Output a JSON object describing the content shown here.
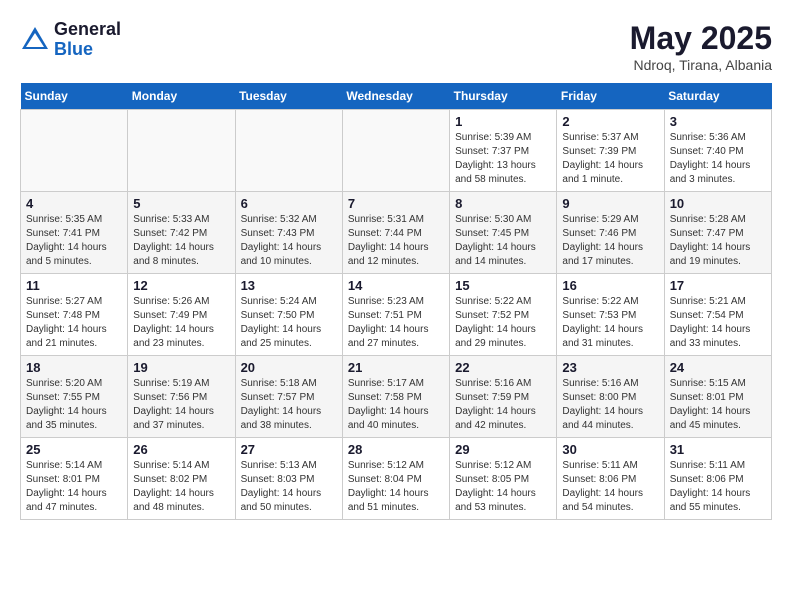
{
  "header": {
    "logo_general": "General",
    "logo_blue": "Blue",
    "month_title": "May 2025",
    "location": "Ndroq, Tirana, Albania"
  },
  "weekdays": [
    "Sunday",
    "Monday",
    "Tuesday",
    "Wednesday",
    "Thursday",
    "Friday",
    "Saturday"
  ],
  "weeks": [
    [
      {
        "day": "",
        "info": ""
      },
      {
        "day": "",
        "info": ""
      },
      {
        "day": "",
        "info": ""
      },
      {
        "day": "",
        "info": ""
      },
      {
        "day": "1",
        "info": "Sunrise: 5:39 AM\nSunset: 7:37 PM\nDaylight: 13 hours\nand 58 minutes."
      },
      {
        "day": "2",
        "info": "Sunrise: 5:37 AM\nSunset: 7:39 PM\nDaylight: 14 hours\nand 1 minute."
      },
      {
        "day": "3",
        "info": "Sunrise: 5:36 AM\nSunset: 7:40 PM\nDaylight: 14 hours\nand 3 minutes."
      }
    ],
    [
      {
        "day": "4",
        "info": "Sunrise: 5:35 AM\nSunset: 7:41 PM\nDaylight: 14 hours\nand 5 minutes."
      },
      {
        "day": "5",
        "info": "Sunrise: 5:33 AM\nSunset: 7:42 PM\nDaylight: 14 hours\nand 8 minutes."
      },
      {
        "day": "6",
        "info": "Sunrise: 5:32 AM\nSunset: 7:43 PM\nDaylight: 14 hours\nand 10 minutes."
      },
      {
        "day": "7",
        "info": "Sunrise: 5:31 AM\nSunset: 7:44 PM\nDaylight: 14 hours\nand 12 minutes."
      },
      {
        "day": "8",
        "info": "Sunrise: 5:30 AM\nSunset: 7:45 PM\nDaylight: 14 hours\nand 14 minutes."
      },
      {
        "day": "9",
        "info": "Sunrise: 5:29 AM\nSunset: 7:46 PM\nDaylight: 14 hours\nand 17 minutes."
      },
      {
        "day": "10",
        "info": "Sunrise: 5:28 AM\nSunset: 7:47 PM\nDaylight: 14 hours\nand 19 minutes."
      }
    ],
    [
      {
        "day": "11",
        "info": "Sunrise: 5:27 AM\nSunset: 7:48 PM\nDaylight: 14 hours\nand 21 minutes."
      },
      {
        "day": "12",
        "info": "Sunrise: 5:26 AM\nSunset: 7:49 PM\nDaylight: 14 hours\nand 23 minutes."
      },
      {
        "day": "13",
        "info": "Sunrise: 5:24 AM\nSunset: 7:50 PM\nDaylight: 14 hours\nand 25 minutes."
      },
      {
        "day": "14",
        "info": "Sunrise: 5:23 AM\nSunset: 7:51 PM\nDaylight: 14 hours\nand 27 minutes."
      },
      {
        "day": "15",
        "info": "Sunrise: 5:22 AM\nSunset: 7:52 PM\nDaylight: 14 hours\nand 29 minutes."
      },
      {
        "day": "16",
        "info": "Sunrise: 5:22 AM\nSunset: 7:53 PM\nDaylight: 14 hours\nand 31 minutes."
      },
      {
        "day": "17",
        "info": "Sunrise: 5:21 AM\nSunset: 7:54 PM\nDaylight: 14 hours\nand 33 minutes."
      }
    ],
    [
      {
        "day": "18",
        "info": "Sunrise: 5:20 AM\nSunset: 7:55 PM\nDaylight: 14 hours\nand 35 minutes."
      },
      {
        "day": "19",
        "info": "Sunrise: 5:19 AM\nSunset: 7:56 PM\nDaylight: 14 hours\nand 37 minutes."
      },
      {
        "day": "20",
        "info": "Sunrise: 5:18 AM\nSunset: 7:57 PM\nDaylight: 14 hours\nand 38 minutes."
      },
      {
        "day": "21",
        "info": "Sunrise: 5:17 AM\nSunset: 7:58 PM\nDaylight: 14 hours\nand 40 minutes."
      },
      {
        "day": "22",
        "info": "Sunrise: 5:16 AM\nSunset: 7:59 PM\nDaylight: 14 hours\nand 42 minutes."
      },
      {
        "day": "23",
        "info": "Sunrise: 5:16 AM\nSunset: 8:00 PM\nDaylight: 14 hours\nand 44 minutes."
      },
      {
        "day": "24",
        "info": "Sunrise: 5:15 AM\nSunset: 8:01 PM\nDaylight: 14 hours\nand 45 minutes."
      }
    ],
    [
      {
        "day": "25",
        "info": "Sunrise: 5:14 AM\nSunset: 8:01 PM\nDaylight: 14 hours\nand 47 minutes."
      },
      {
        "day": "26",
        "info": "Sunrise: 5:14 AM\nSunset: 8:02 PM\nDaylight: 14 hours\nand 48 minutes."
      },
      {
        "day": "27",
        "info": "Sunrise: 5:13 AM\nSunset: 8:03 PM\nDaylight: 14 hours\nand 50 minutes."
      },
      {
        "day": "28",
        "info": "Sunrise: 5:12 AM\nSunset: 8:04 PM\nDaylight: 14 hours\nand 51 minutes."
      },
      {
        "day": "29",
        "info": "Sunrise: 5:12 AM\nSunset: 8:05 PM\nDaylight: 14 hours\nand 53 minutes."
      },
      {
        "day": "30",
        "info": "Sunrise: 5:11 AM\nSunset: 8:06 PM\nDaylight: 14 hours\nand 54 minutes."
      },
      {
        "day": "31",
        "info": "Sunrise: 5:11 AM\nSunset: 8:06 PM\nDaylight: 14 hours\nand 55 minutes."
      }
    ]
  ]
}
